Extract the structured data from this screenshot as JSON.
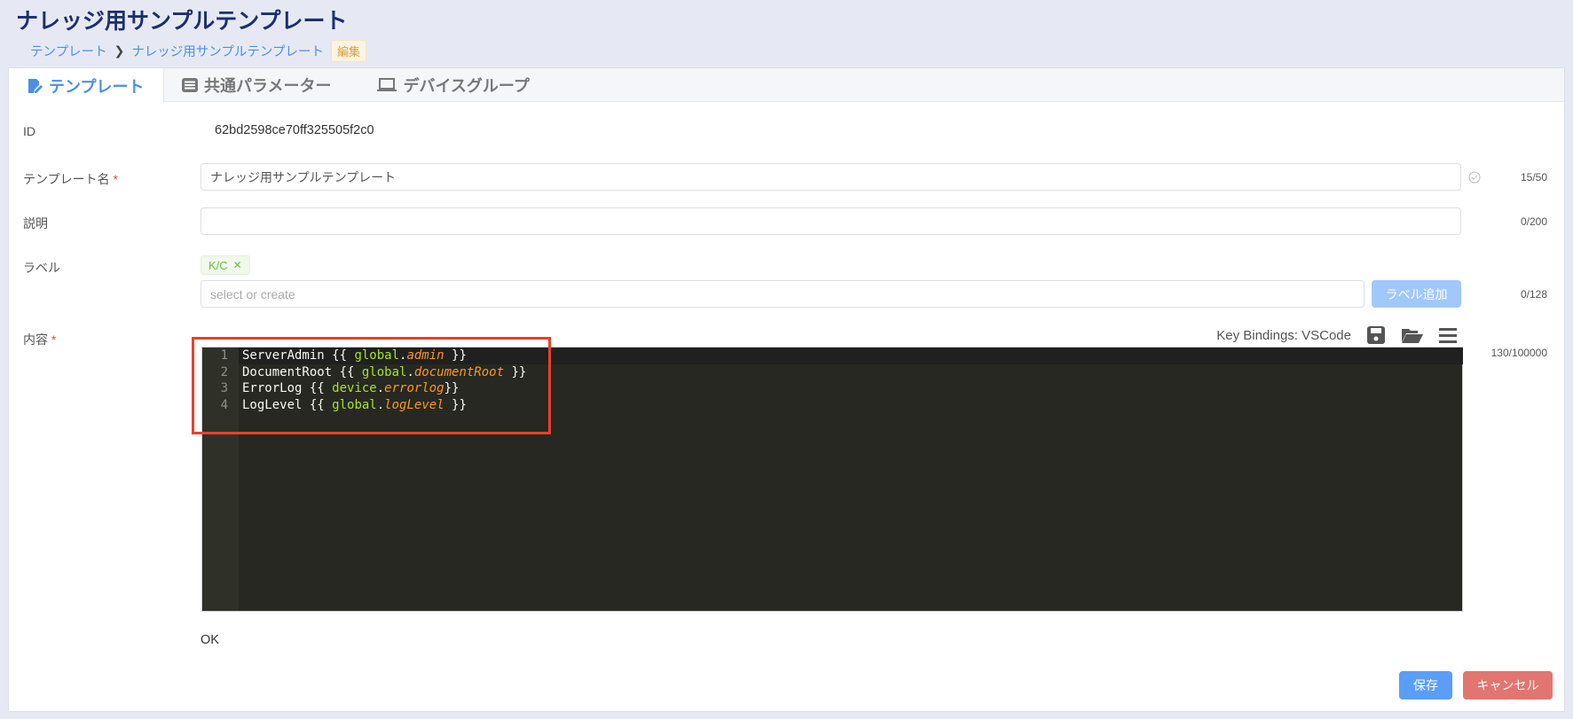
{
  "page_title": "ナレッジ用サンプルテンプレート",
  "breadcrumb": {
    "items": [
      "テンプレート",
      "ナレッジ用サンプルテンプレート"
    ],
    "badge": "編集"
  },
  "tabs": [
    {
      "label": "テンプレート",
      "icon": "edit-icon",
      "active": true
    },
    {
      "label": "共通パラメーター",
      "icon": "list-icon"
    },
    {
      "label": "デバイスグループ",
      "icon": "laptop-icon"
    }
  ],
  "form": {
    "id_label": "ID",
    "id_value": "62bd2598ce70ff325505f2c0",
    "name_label": "テンプレート名",
    "name_value": "ナレッジ用サンプルテンプレート",
    "name_count": "15/50",
    "desc_label": "説明",
    "desc_value": "",
    "desc_count": "0/200",
    "label_label": "ラベル",
    "tags": [
      "K/C"
    ],
    "label_placeholder": "select or create",
    "label_add": "ラベル追加",
    "label_count": "0/128",
    "content_label": "内容",
    "key_bindings": "Key Bindings: VSCode",
    "content_count": "130/100000",
    "status": "OK"
  },
  "editor": {
    "lines": [
      {
        "n": "1",
        "parts": [
          [
            "ServerAdmin {{ ",
            ""
          ],
          [
            "global",
            "g"
          ],
          [
            ".",
            ""
          ],
          [
            "admin",
            "v"
          ],
          [
            " }}",
            ""
          ]
        ]
      },
      {
        "n": "2",
        "parts": [
          [
            "DocumentRoot {{ ",
            ""
          ],
          [
            "global",
            "g"
          ],
          [
            ".",
            ""
          ],
          [
            "documentRoot",
            "v"
          ],
          [
            " }}",
            ""
          ]
        ]
      },
      {
        "n": "3",
        "parts": [
          [
            "ErrorLog {{ ",
            ""
          ],
          [
            "device",
            "g"
          ],
          [
            ".",
            ""
          ],
          [
            "errorlog",
            "v"
          ],
          [
            "}}",
            ""
          ]
        ]
      },
      {
        "n": "4",
        "parts": [
          [
            "LogLevel {{ ",
            ""
          ],
          [
            "global",
            "g"
          ],
          [
            ".",
            ""
          ],
          [
            "logLevel",
            "v"
          ],
          [
            " }}",
            ""
          ]
        ]
      }
    ]
  },
  "buttons": {
    "save": "保存",
    "cancel": "キャンセル"
  },
  "colors": {
    "primary": "#5b9ef7",
    "danger": "#e37570",
    "highlight": "#e8412c"
  }
}
